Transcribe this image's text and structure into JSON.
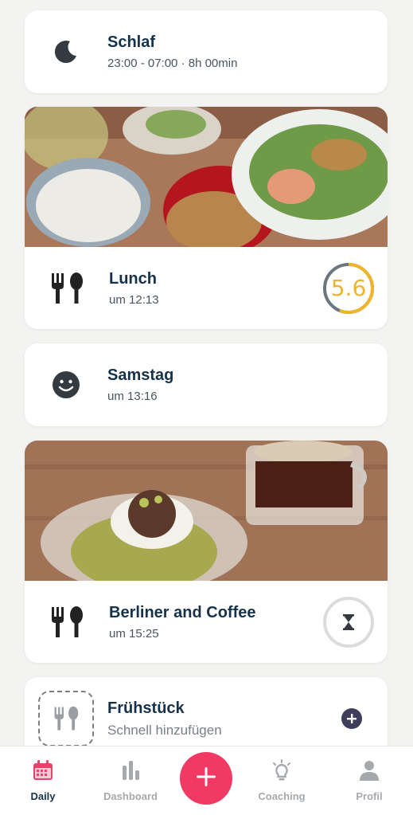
{
  "sleep": {
    "title": "Schlaf",
    "time": "23:00 - 07:00 · 8h 00min",
    "icon": "moon-icon"
  },
  "lunch": {
    "title": "Lunch",
    "time": "um 12:13",
    "score": "5.6",
    "score_fraction": 0.56,
    "icon": "fork-spoon-icon"
  },
  "mood": {
    "title": "Samstag",
    "time": "um 13:16",
    "icon": "smiley-icon"
  },
  "snack": {
    "title": "Berliner and Coffee",
    "time": "um 15:25",
    "status_icon": "hourglass-icon",
    "icon": "fork-spoon-icon"
  },
  "breakfast": {
    "title": "Frühstück",
    "subtitle": "Schnell hinzufügen",
    "icon": "fork-spoon-icon",
    "action_icon": "plus-circle-icon"
  },
  "tabbar": {
    "tabs": [
      {
        "label": "Daily",
        "icon": "calendar-icon",
        "active": true
      },
      {
        "label": "Dashboard",
        "icon": "bar-chart-icon",
        "active": false
      },
      {
        "label": "Coaching",
        "icon": "lightbulb-icon",
        "active": false
      },
      {
        "label": "Profil",
        "icon": "person-icon",
        "active": false
      }
    ],
    "fab_icon": "plus-icon"
  },
  "colors": {
    "accent": "#f03a63",
    "score": "#f0b429",
    "score_track": "#6b7680",
    "title": "#16324a",
    "active_tab": "#e8426b"
  }
}
